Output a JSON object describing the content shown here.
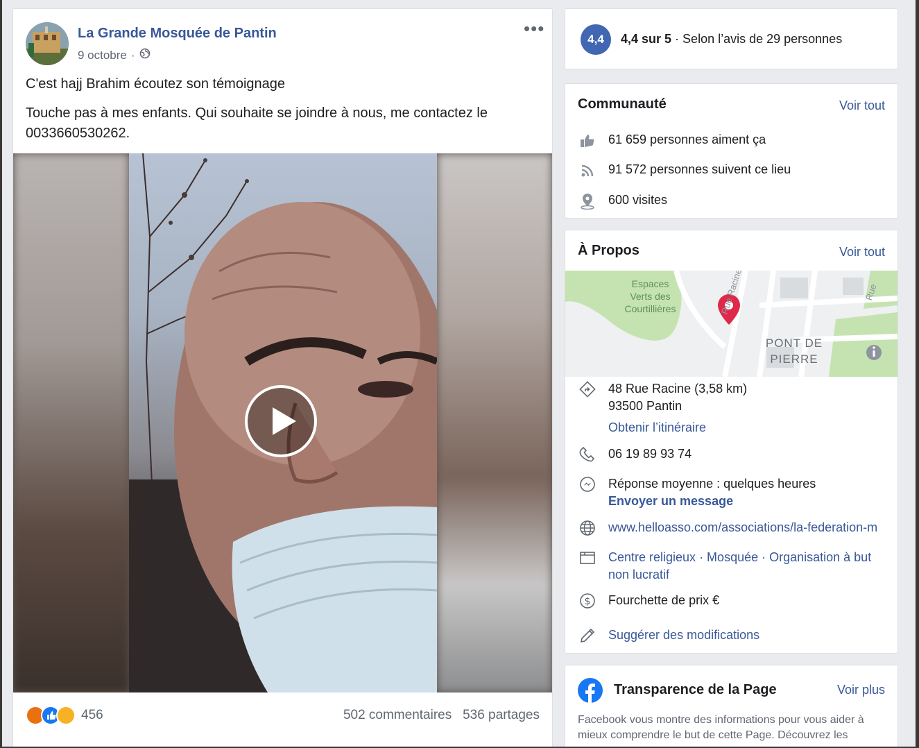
{
  "post": {
    "page_name": "La Grande Mosquée de Pantin",
    "date": "9 octobre",
    "more_label": "•••",
    "text_line1": "C'est hajj Brahim écoutez son témoignage",
    "text_line2": "Touche pas à mes enfants. Qui souhaite se joindre à nous, me contactez le 0033660530262.",
    "reaction_count": "456",
    "comments": "502 commentaires",
    "shares": "536 partages"
  },
  "rating": {
    "badge": "4,4",
    "score": "4,4 sur 5",
    "separator": " · ",
    "detail": "Selon l’avis de 29 personnes"
  },
  "community": {
    "title": "Communauté",
    "see_all": "Voir tout",
    "likes": "61 659 personnes aiment ça",
    "followers": "91 572 personnes suivent ce lieu",
    "visits": "600 visites"
  },
  "about": {
    "title": "À Propos",
    "see_all": "Voir tout",
    "map": {
      "park_label": "Espaces Verts des Courtillières",
      "street_label": "Rue Racine",
      "area_label": "PONT DE PIERRE",
      "street_label2": "Rue"
    },
    "address_line1": "48 Rue Racine (3,58 km)",
    "address_line2": "93500 Pantin",
    "directions": "Obtenir l’itinéraire",
    "phone": "06 19 89 93 74",
    "response": "Réponse moyenne : quelques heures",
    "send_message": "Envoyer un message",
    "website": "www.helloasso.com/associations/la-federation-m",
    "categories": "Centre religieux · Mosquée · Organisation à but non lucratif",
    "price": "Fourchette de prix €",
    "suggest": "Suggérer des modifications"
  },
  "transparency": {
    "title": "Transparence de la Page",
    "see_more": "Voir plus",
    "description": "Facebook vous montre des informations pour vous aider à mieux comprendre le but de cette Page. Découvrez les"
  }
}
